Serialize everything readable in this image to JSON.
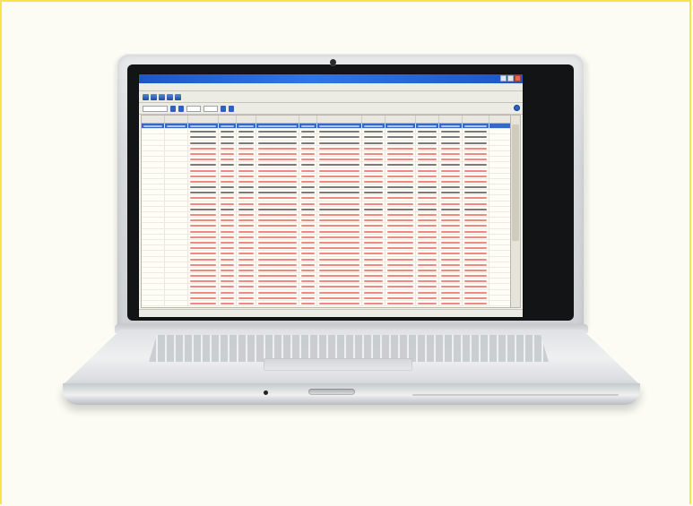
{
  "device": {
    "type": "laptop",
    "screen": {
      "app": {
        "window_title": "",
        "menu_items": [],
        "status_text": ""
      }
    }
  },
  "colors": {
    "frame_border": "#f3e64a",
    "titlebar_blue": "#2f76e8",
    "red_rows": "#ee8a84"
  },
  "icons": [
    "camera-icon",
    "help-icon"
  ]
}
